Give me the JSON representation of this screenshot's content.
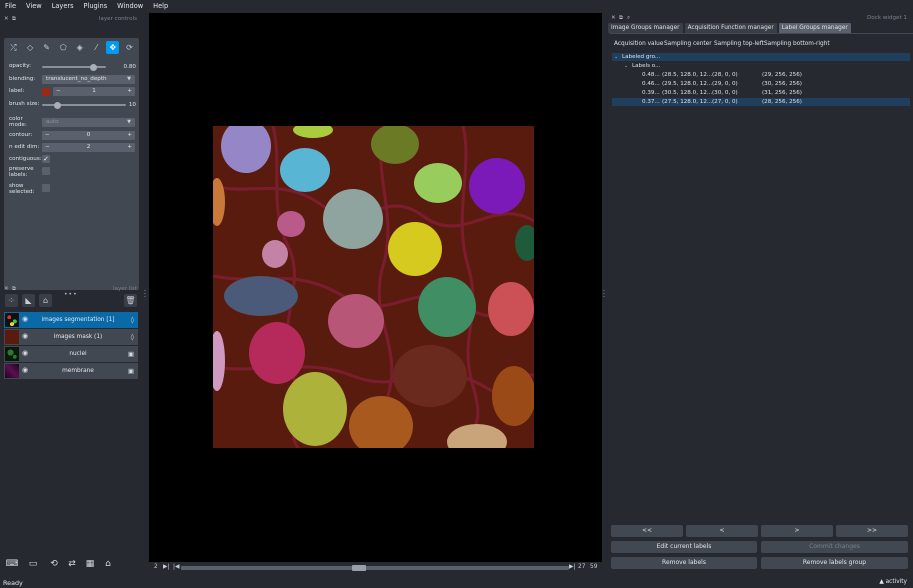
{
  "menubar": {
    "items": [
      "File",
      "View",
      "Layers",
      "Plugins",
      "Window",
      "Help"
    ]
  },
  "left_dock": {
    "controls_title": "layer controls",
    "list_title": "layer list"
  },
  "controls": {
    "opacity": {
      "label": "opacity:",
      "value": "0.80",
      "fraction": 0.8
    },
    "blending": {
      "label": "blending:",
      "value": "translucent_no_depth"
    },
    "label": {
      "label": "label:",
      "value": "1",
      "color": "#9a2a14"
    },
    "brush_size": {
      "label": "brush size:",
      "value": "10",
      "fraction": 0.18
    },
    "color_mode": {
      "label": "color mode:",
      "value": "auto"
    },
    "contour": {
      "label": "contour:",
      "value": "0"
    },
    "n_edit_dim": {
      "label": "n edit dim:",
      "value": "2"
    },
    "contiguous": {
      "label": "contiguous:",
      "checked": true
    },
    "preserve": {
      "label": "preserve\nlabels:",
      "checked": false
    },
    "show": {
      "label": "show\nselected:",
      "checked": false
    }
  },
  "layers": [
    {
      "name": "images segmentation [1]",
      "type": "labels",
      "selected": true
    },
    {
      "name": "images mask (1)",
      "type": "labels",
      "selected": false
    },
    {
      "name": "nuclei",
      "type": "image",
      "selected": false
    },
    {
      "name": "membrane",
      "type": "image",
      "selected": false
    }
  ],
  "dims": {
    "left": "2",
    "current": "27",
    "max": "59"
  },
  "right_dock": {
    "title": "Dock widget 1"
  },
  "tabs": [
    "Image Groups manager",
    "Acquisition Function manager",
    "Label Groups manager"
  ],
  "tree": {
    "headers": [
      "Acquisition value",
      "Sampling center",
      "Sampling top-left",
      "Sampling bottom-right"
    ],
    "group": "Labeled gro...",
    "sub": "Labels o...",
    "rows": [
      {
        "acq": "0.48...",
        "center": "(28.5, 128.0, 12...",
        "tl": "(28, 0, 0)",
        "br": "(29, 256, 256)"
      },
      {
        "acq": "0.46...",
        "center": "(29.5, 128.0, 12...",
        "tl": "(29, 0, 0)",
        "br": "(30, 256, 256)"
      },
      {
        "acq": "0.39...",
        "center": "(30.5, 128.0, 12...",
        "tl": "(30, 0, 0)",
        "br": "(31, 256, 256)"
      },
      {
        "acq": "0.37...",
        "center": "(27.5, 128.0, 12...",
        "tl": "(27, 0, 0)",
        "br": "(28, 256, 256)"
      }
    ]
  },
  "nav": {
    "first": "<<",
    "prev": "<",
    "next": ">",
    "last": ">>"
  },
  "buttons": {
    "edit": "Edit current labels",
    "commit": "Commit changes",
    "remove_labels": "Remove labels",
    "remove_group": "Remove labels group"
  },
  "status": {
    "text": "Ready",
    "activity": "activity"
  }
}
